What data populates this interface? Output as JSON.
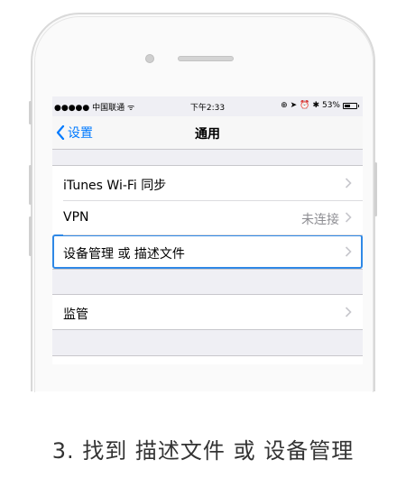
{
  "statusbar": {
    "carrier": "●●●●● 中国联通 ᯤ",
    "time": "下午2:33",
    "battery_text": "53%",
    "battery_level": 0.53
  },
  "navbar": {
    "back_label": "设置",
    "title": "通用"
  },
  "groups": [
    {
      "rows": [
        {
          "label": "iTunes Wi-Fi 同步",
          "value": ""
        },
        {
          "label": "VPN",
          "value": "未连接"
        },
        {
          "label": "设备管理 或 描述文件",
          "value": ""
        }
      ]
    },
    {
      "rows": [
        {
          "label": "监管",
          "value": ""
        }
      ]
    }
  ],
  "caption": "3. 找到 描述文件 或 设备管理",
  "colors": {
    "accent": "#007aff",
    "highlight": "#2f88e6",
    "background": "#efeff4"
  }
}
